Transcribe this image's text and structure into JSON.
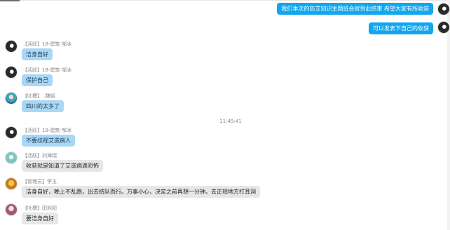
{
  "chat": {
    "outgoing": [
      {
        "text": "我们本次的防艾知识主题班会就到此结束 希望大家有所收获"
      },
      {
        "text": "可以发表下自己的收获"
      }
    ],
    "timestamp": "11:49:41",
    "incoming": [
      {
        "sender": "【活跃】18-建筑-邹冰",
        "text": "洁身自好"
      },
      {
        "sender": "【活跃】18-建筑-邹冰",
        "text": "保护自己"
      },
      {
        "sender": "【吐槽】..魏娟",
        "text": "四川的太多了"
      },
      {
        "sender": "【活跃】18-建筑-邹冰",
        "text": "不要歧视艾滋病人"
      },
      {
        "sender": "【活跃】刘海瑞",
        "text": "收获就是知道了艾滋病滴恐怖"
      },
      {
        "sender": "【管理员】李玉",
        "text": "洁身自好，晚上不乱跑，出去结队而行。万事小心，决定之前再想一分钟。去正规地方打耳洞"
      },
      {
        "sender": "【吐槽】田旭阳",
        "text": "要洁身自好"
      }
    ]
  },
  "colors": {
    "self_bubble": "#12a6ee",
    "highlight_bubble": "#a9d7f5",
    "normal_bubble": "#e7e7e7"
  }
}
